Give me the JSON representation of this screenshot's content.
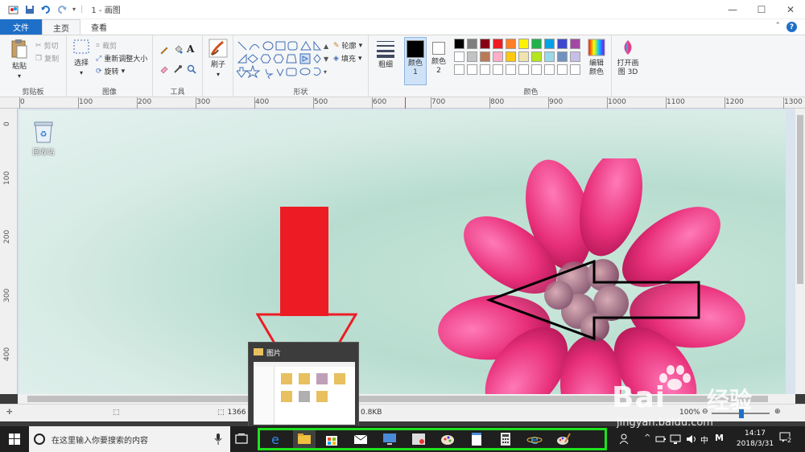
{
  "window": {
    "title": "1 - 画图",
    "controls": {
      "minimize": "—",
      "maximize": "☐",
      "close": "✕"
    }
  },
  "tabs": [
    {
      "label": "文件"
    },
    {
      "label": "主页"
    },
    {
      "label": "查看"
    }
  ],
  "ribbon": {
    "clipboard": {
      "label": "剪贴板",
      "paste": "粘贴",
      "cut": "剪切",
      "copy": "复制"
    },
    "image": {
      "label": "图像",
      "select": "选择",
      "crop": "裁剪",
      "resize": "重新调整大小",
      "rotate": "旋转"
    },
    "tools": {
      "label": "工具"
    },
    "brushes": {
      "label": "刷子"
    },
    "shapes": {
      "label": "形状",
      "outline": "轮廓",
      "fill": "填充"
    },
    "size": {
      "label": "粗细"
    },
    "color1": {
      "label": "颜色 1"
    },
    "color2": {
      "label": "颜色 2"
    },
    "colors": {
      "label": "颜色",
      "edit": "编辑颜色"
    },
    "paint3d": {
      "label": "打开画图 3D"
    }
  },
  "palette": {
    "row1": [
      "#000000",
      "#7f7f7f",
      "#880015",
      "#ed1c24",
      "#ff7f27",
      "#fff200",
      "#22b14c",
      "#00a2e8",
      "#3f48cc",
      "#a349a4"
    ],
    "row2": [
      "#ffffff",
      "#c3c3c3",
      "#b97a57",
      "#ffaec9",
      "#ffc90e",
      "#efe4b0",
      "#b5e61d",
      "#99d9ea",
      "#7092be",
      "#c8bfe7"
    ],
    "row3": [
      "#ffffff",
      "#ffffff",
      "#ffffff",
      "#ffffff",
      "#ffffff",
      "#ffffff",
      "#ffffff",
      "#ffffff",
      "#ffffff",
      "#ffffff"
    ]
  },
  "ruler": {
    "h": [
      "0",
      "100",
      "200",
      "300",
      "400",
      "500",
      "600",
      "700",
      "800",
      "900",
      "1000",
      "1100",
      "1200",
      "1300"
    ],
    "v": [
      "0",
      "100",
      "200",
      "300",
      "400"
    ]
  },
  "desktop": {
    "recycle_bin": "回收站"
  },
  "status": {
    "dimensions": "1366",
    "filesize": "0.8KB",
    "zoom": "100%"
  },
  "taskbar": {
    "search_placeholder": "在这里输入你要搜索的内容",
    "preview_title": "图片",
    "ime": "中",
    "ime2": "M",
    "time": "14:17",
    "date": "2018/3/31",
    "notifications": "2"
  },
  "watermark": {
    "brand": "Bai",
    "brand_cn": "经验",
    "url": "jingyan.baidu.com"
  },
  "colors": {
    "accent": "#1e6fc8",
    "highlight": "#1fe11f",
    "arrow_red": "#ed1c24"
  }
}
